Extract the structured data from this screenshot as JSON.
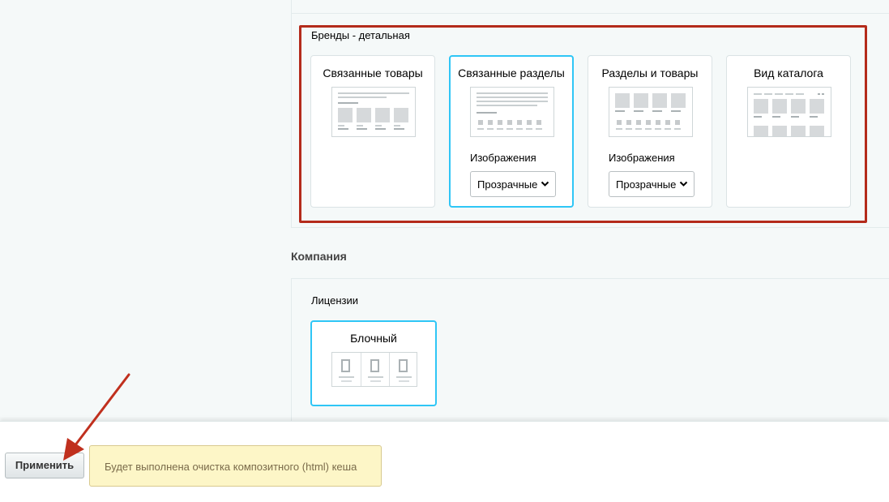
{
  "brands_detail": {
    "title": "Бренды - детальная",
    "cards": [
      {
        "title": "Связанные товары",
        "selected": false
      },
      {
        "title": "Связанные разделы",
        "selected": true,
        "option_label": "Изображения",
        "option_value": "Прозрачные"
      },
      {
        "title": "Разделы и товары",
        "selected": false,
        "option_label": "Изображения",
        "option_value": "Прозрачные"
      },
      {
        "title": "Вид каталога",
        "selected": false
      }
    ]
  },
  "company": {
    "heading": "Компания",
    "licenses": {
      "title": "Лицензии",
      "card_title": "Блочный"
    }
  },
  "footer": {
    "apply_label": "Применить",
    "notice": "Будет выполнена очистка композитного (html) кеша"
  },
  "colors": {
    "highlight_border": "#b42b1b",
    "selected_border": "#2fc6f6",
    "notice_bg": "#fdf6c7",
    "arrow": "#c0301e"
  },
  "icons": [
    "chevron-down-icon",
    "arrow-annotation"
  ]
}
